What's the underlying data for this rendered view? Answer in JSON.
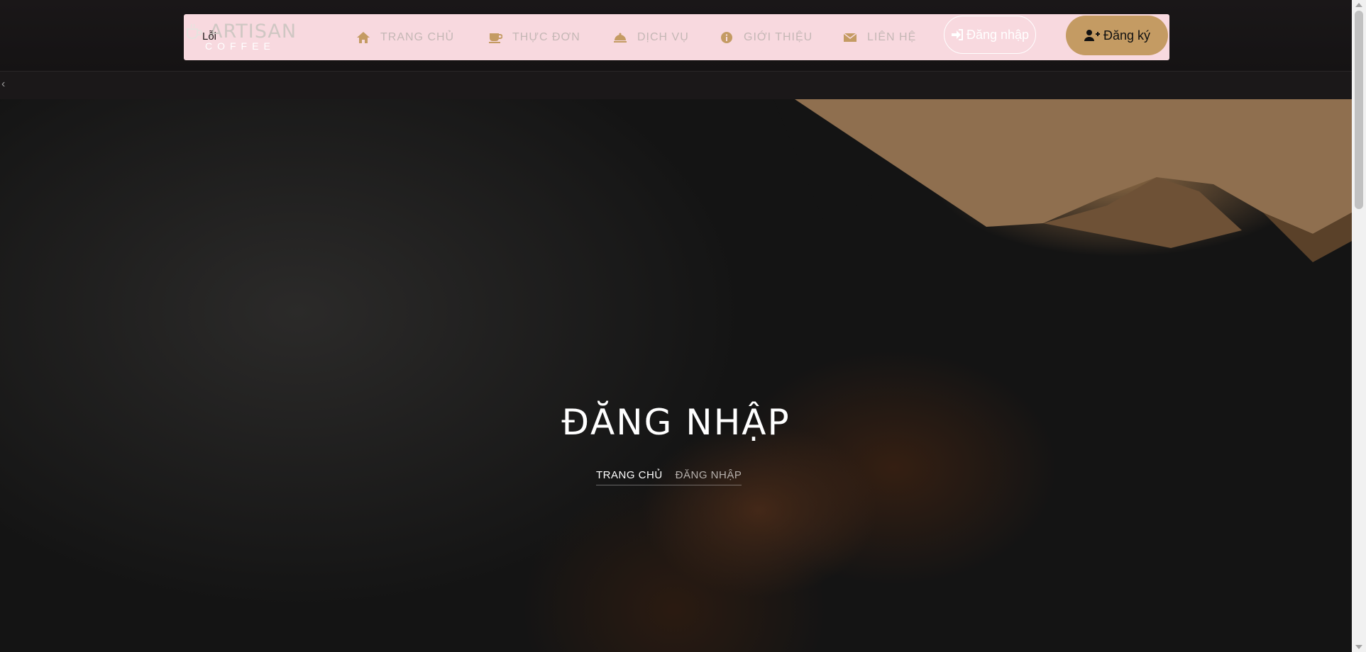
{
  "brand": {
    "name": "ARTISAN",
    "sub": "COFFEE",
    "error_text": "Lỗi"
  },
  "nav": {
    "items": [
      {
        "label": "TRANG CHỦ",
        "icon": "home-icon"
      },
      {
        "label": "THỰC ĐƠN",
        "icon": "coffee-cup-icon"
      },
      {
        "label": "DỊCH VỤ",
        "icon": "cloche-icon"
      },
      {
        "label": "GIỚI THIỆU",
        "icon": "info-circle-icon"
      },
      {
        "label": "LIÊN HỆ",
        "icon": "envelope-icon"
      }
    ],
    "login_label": "Đăng nhập",
    "register_label": "Đăng ký"
  },
  "hero": {
    "title": "ĐĂNG NHẬP",
    "breadcrumb": {
      "home": "TRANG CHỦ",
      "current": "ĐĂNG NHẬP"
    }
  },
  "colors": {
    "navbar_bg": "#f8d9df",
    "accent_gold": "#c49b63",
    "nav_text": "#c4b7b5",
    "nav_icon": "#c49b63"
  }
}
